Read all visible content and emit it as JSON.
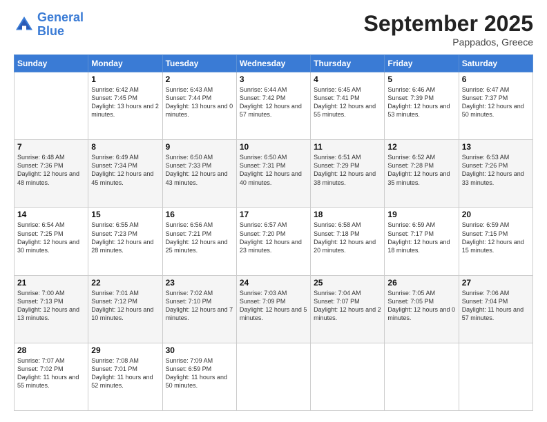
{
  "logo": {
    "line1": "General",
    "line2": "Blue"
  },
  "title": "September 2025",
  "subtitle": "Pappados, Greece",
  "days": [
    "Sunday",
    "Monday",
    "Tuesday",
    "Wednesday",
    "Thursday",
    "Friday",
    "Saturday"
  ],
  "weeks": [
    [
      {
        "day": "",
        "sunrise": "",
        "sunset": "",
        "daylight": ""
      },
      {
        "day": "1",
        "sunrise": "Sunrise: 6:42 AM",
        "sunset": "Sunset: 7:45 PM",
        "daylight": "Daylight: 13 hours and 2 minutes."
      },
      {
        "day": "2",
        "sunrise": "Sunrise: 6:43 AM",
        "sunset": "Sunset: 7:44 PM",
        "daylight": "Daylight: 13 hours and 0 minutes."
      },
      {
        "day": "3",
        "sunrise": "Sunrise: 6:44 AM",
        "sunset": "Sunset: 7:42 PM",
        "daylight": "Daylight: 12 hours and 57 minutes."
      },
      {
        "day": "4",
        "sunrise": "Sunrise: 6:45 AM",
        "sunset": "Sunset: 7:41 PM",
        "daylight": "Daylight: 12 hours and 55 minutes."
      },
      {
        "day": "5",
        "sunrise": "Sunrise: 6:46 AM",
        "sunset": "Sunset: 7:39 PM",
        "daylight": "Daylight: 12 hours and 53 minutes."
      },
      {
        "day": "6",
        "sunrise": "Sunrise: 6:47 AM",
        "sunset": "Sunset: 7:37 PM",
        "daylight": "Daylight: 12 hours and 50 minutes."
      }
    ],
    [
      {
        "day": "7",
        "sunrise": "Sunrise: 6:48 AM",
        "sunset": "Sunset: 7:36 PM",
        "daylight": "Daylight: 12 hours and 48 minutes."
      },
      {
        "day": "8",
        "sunrise": "Sunrise: 6:49 AM",
        "sunset": "Sunset: 7:34 PM",
        "daylight": "Daylight: 12 hours and 45 minutes."
      },
      {
        "day": "9",
        "sunrise": "Sunrise: 6:50 AM",
        "sunset": "Sunset: 7:33 PM",
        "daylight": "Daylight: 12 hours and 43 minutes."
      },
      {
        "day": "10",
        "sunrise": "Sunrise: 6:50 AM",
        "sunset": "Sunset: 7:31 PM",
        "daylight": "Daylight: 12 hours and 40 minutes."
      },
      {
        "day": "11",
        "sunrise": "Sunrise: 6:51 AM",
        "sunset": "Sunset: 7:29 PM",
        "daylight": "Daylight: 12 hours and 38 minutes."
      },
      {
        "day": "12",
        "sunrise": "Sunrise: 6:52 AM",
        "sunset": "Sunset: 7:28 PM",
        "daylight": "Daylight: 12 hours and 35 minutes."
      },
      {
        "day": "13",
        "sunrise": "Sunrise: 6:53 AM",
        "sunset": "Sunset: 7:26 PM",
        "daylight": "Daylight: 12 hours and 33 minutes."
      }
    ],
    [
      {
        "day": "14",
        "sunrise": "Sunrise: 6:54 AM",
        "sunset": "Sunset: 7:25 PM",
        "daylight": "Daylight: 12 hours and 30 minutes."
      },
      {
        "day": "15",
        "sunrise": "Sunrise: 6:55 AM",
        "sunset": "Sunset: 7:23 PM",
        "daylight": "Daylight: 12 hours and 28 minutes."
      },
      {
        "day": "16",
        "sunrise": "Sunrise: 6:56 AM",
        "sunset": "Sunset: 7:21 PM",
        "daylight": "Daylight: 12 hours and 25 minutes."
      },
      {
        "day": "17",
        "sunrise": "Sunrise: 6:57 AM",
        "sunset": "Sunset: 7:20 PM",
        "daylight": "Daylight: 12 hours and 23 minutes."
      },
      {
        "day": "18",
        "sunrise": "Sunrise: 6:58 AM",
        "sunset": "Sunset: 7:18 PM",
        "daylight": "Daylight: 12 hours and 20 minutes."
      },
      {
        "day": "19",
        "sunrise": "Sunrise: 6:59 AM",
        "sunset": "Sunset: 7:17 PM",
        "daylight": "Daylight: 12 hours and 18 minutes."
      },
      {
        "day": "20",
        "sunrise": "Sunrise: 6:59 AM",
        "sunset": "Sunset: 7:15 PM",
        "daylight": "Daylight: 12 hours and 15 minutes."
      }
    ],
    [
      {
        "day": "21",
        "sunrise": "Sunrise: 7:00 AM",
        "sunset": "Sunset: 7:13 PM",
        "daylight": "Daylight: 12 hours and 13 minutes."
      },
      {
        "day": "22",
        "sunrise": "Sunrise: 7:01 AM",
        "sunset": "Sunset: 7:12 PM",
        "daylight": "Daylight: 12 hours and 10 minutes."
      },
      {
        "day": "23",
        "sunrise": "Sunrise: 7:02 AM",
        "sunset": "Sunset: 7:10 PM",
        "daylight": "Daylight: 12 hours and 7 minutes."
      },
      {
        "day": "24",
        "sunrise": "Sunrise: 7:03 AM",
        "sunset": "Sunset: 7:09 PM",
        "daylight": "Daylight: 12 hours and 5 minutes."
      },
      {
        "day": "25",
        "sunrise": "Sunrise: 7:04 AM",
        "sunset": "Sunset: 7:07 PM",
        "daylight": "Daylight: 12 hours and 2 minutes."
      },
      {
        "day": "26",
        "sunrise": "Sunrise: 7:05 AM",
        "sunset": "Sunset: 7:05 PM",
        "daylight": "Daylight: 12 hours and 0 minutes."
      },
      {
        "day": "27",
        "sunrise": "Sunrise: 7:06 AM",
        "sunset": "Sunset: 7:04 PM",
        "daylight": "Daylight: 11 hours and 57 minutes."
      }
    ],
    [
      {
        "day": "28",
        "sunrise": "Sunrise: 7:07 AM",
        "sunset": "Sunset: 7:02 PM",
        "daylight": "Daylight: 11 hours and 55 minutes."
      },
      {
        "day": "29",
        "sunrise": "Sunrise: 7:08 AM",
        "sunset": "Sunset: 7:01 PM",
        "daylight": "Daylight: 11 hours and 52 minutes."
      },
      {
        "day": "30",
        "sunrise": "Sunrise: 7:09 AM",
        "sunset": "Sunset: 6:59 PM",
        "daylight": "Daylight: 11 hours and 50 minutes."
      },
      {
        "day": "",
        "sunrise": "",
        "sunset": "",
        "daylight": ""
      },
      {
        "day": "",
        "sunrise": "",
        "sunset": "",
        "daylight": ""
      },
      {
        "day": "",
        "sunrise": "",
        "sunset": "",
        "daylight": ""
      },
      {
        "day": "",
        "sunrise": "",
        "sunset": "",
        "daylight": ""
      }
    ]
  ]
}
